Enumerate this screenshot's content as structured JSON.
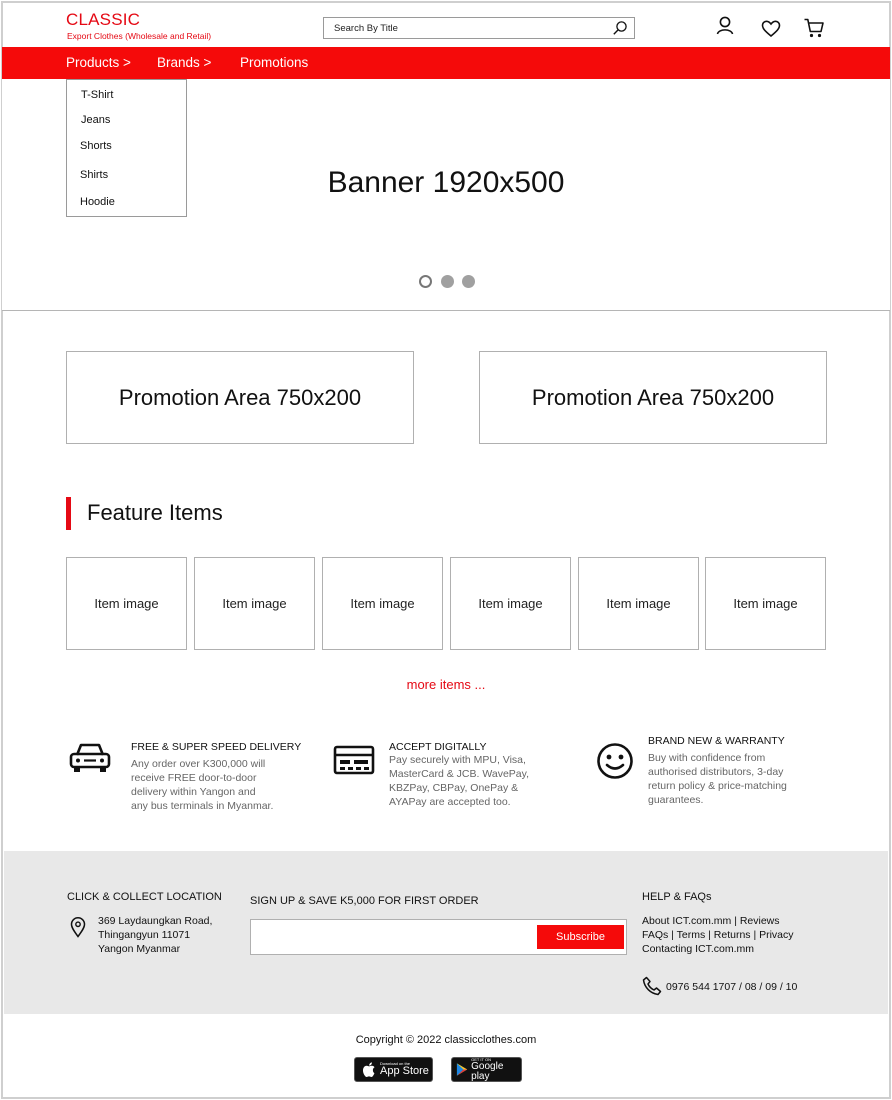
{
  "brand": {
    "title": "CLASSIC",
    "subtitle": "Export Clothes (Wholesale and Retail)"
  },
  "search": {
    "placeholder": "Search By Title",
    "icon": "search-icon"
  },
  "header_icons": [
    "user-icon",
    "heart-icon",
    "cart-icon"
  ],
  "nav": {
    "items": [
      "Products >",
      "Brands >",
      "Promotions"
    ]
  },
  "dropdown": {
    "items": [
      "T-Shirt",
      "Jeans",
      "Shorts",
      "Shirts",
      "Hoodie"
    ]
  },
  "banner": {
    "text": "Banner 1920x500",
    "slides": 3,
    "active_slide": 1
  },
  "promotions": [
    "Promotion Area 750x200",
    "Promotion Area 750x200"
  ],
  "feature": {
    "title": "Feature Items",
    "items": [
      "Item image",
      "Item image",
      "Item image",
      "Item image",
      "Item image",
      "Item image"
    ],
    "more": "more items ..."
  },
  "services": [
    {
      "icon": "car-icon",
      "title": "FREE & SUPER SPEED DELIVERY",
      "lines": [
        "Any order over K300,000 will",
        "receive FREE door-to-door",
        "delivery within Yangon and",
        "any bus terminals in Myanmar."
      ]
    },
    {
      "icon": "card-icon",
      "title": "ACCEPT DIGITALLY",
      "lines": [
        "Pay securely with MPU, Visa,",
        "MasterCard & JCB. WavePay,",
        "KBZPay, CBPay, OnePay &",
        "AYAPay are accepted too."
      ]
    },
    {
      "icon": "smiley-icon",
      "title": "BRAND NEW & WARRANTY",
      "lines": [
        "Buy with confidence from",
        "authorised distributors, 3-day",
        "return policy & price-matching",
        "guarantees."
      ]
    }
  ],
  "footer": {
    "location_title": "CLICK & COLLECT LOCATION",
    "address": [
      "369 Laydaungkan Road,",
      "Thingangyun 11071",
      "Yangon Myanmar"
    ],
    "signup_title": "SIGN UP & SAVE K5,000 FOR FIRST ORDER",
    "signup_value": "",
    "subscribe_label": "Subscribe",
    "help_title": "HELP & FAQs",
    "help_lines": [
      "About ICT.com.mm | Reviews",
      "FAQs | Terms | Returns | Privacy",
      "Contacting ICT.com.mm"
    ],
    "phone": "0976 544 1707 / 08 / 09 / 10"
  },
  "copyright": "Copyright © 2022 classicclothes.com",
  "stores": {
    "apple_small": "Download on the",
    "apple_big": "App Store",
    "google_small": "GET IT ON",
    "google_big": "Google play"
  },
  "colors": {
    "accent": "#f50a0a",
    "footer_bg": "#e8e8e8",
    "muted_text": "#666666"
  }
}
